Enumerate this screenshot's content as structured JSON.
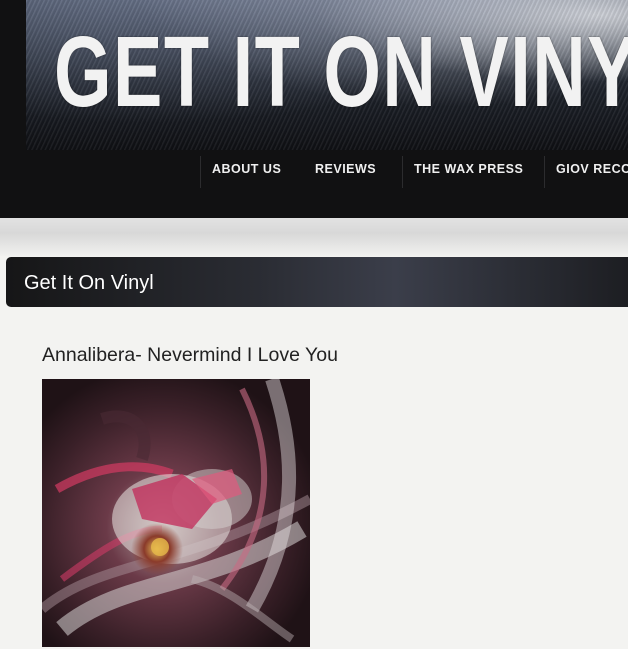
{
  "site": {
    "banner_title": "GET IT ON VINYL"
  },
  "nav": {
    "items": [
      {
        "label": "ABOUT US"
      },
      {
        "label": "REVIEWS"
      },
      {
        "label": "THE WAX PRESS"
      },
      {
        "label": "GIOV RECOR"
      }
    ]
  },
  "page": {
    "heading": "Get It On Vinyl"
  },
  "post": {
    "title": "Annalibera- Nevermind I Love You"
  },
  "colors": {
    "header_bg": "#111112",
    "page_bg": "#f3f3f1",
    "title_bar": "#2a2c33",
    "album_accent": "#c2345a"
  }
}
